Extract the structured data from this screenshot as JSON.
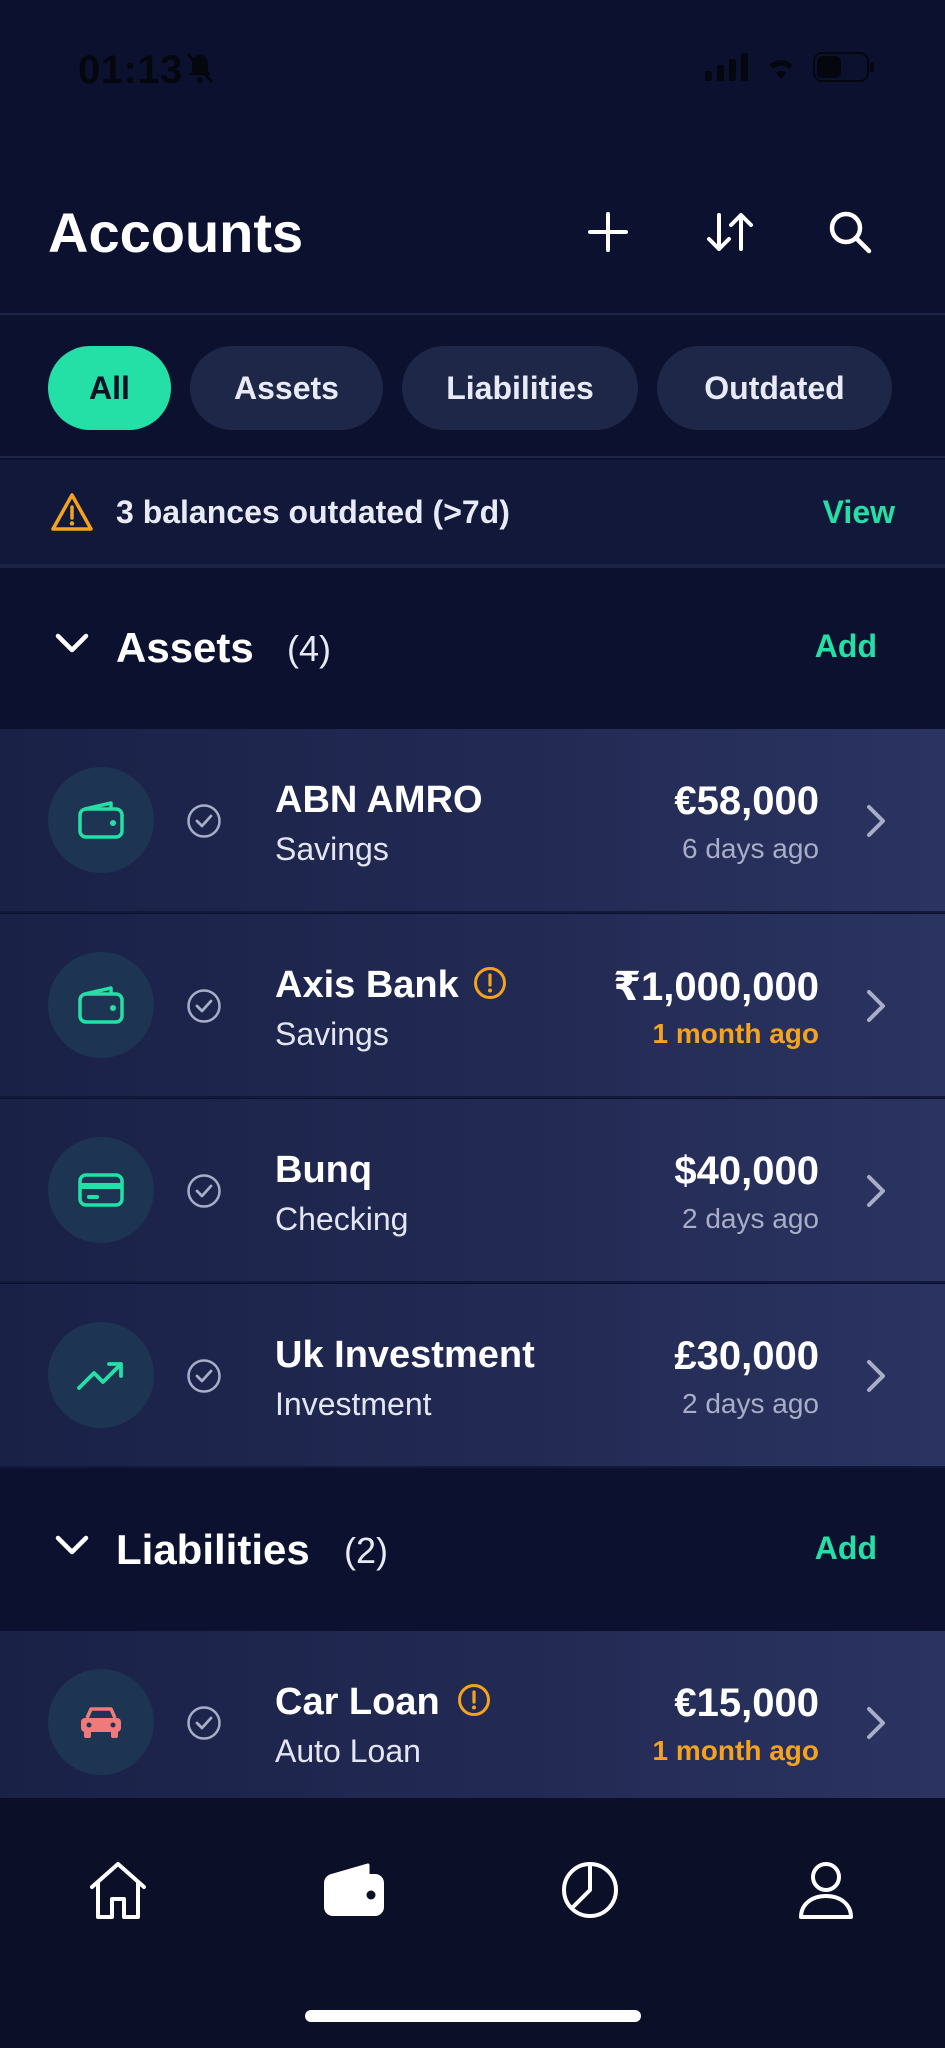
{
  "status_bar": {
    "time": "01:13"
  },
  "header": {
    "title": "Accounts"
  },
  "filters": [
    "All",
    "Assets",
    "Liabilities",
    "Outdated"
  ],
  "banner": {
    "text": "3 balances outdated (>7d)",
    "action": "View"
  },
  "sections": {
    "assets": {
      "title": "Assets",
      "count": "(4)",
      "add": "Add"
    },
    "liabilities": {
      "title": "Liabilities",
      "count": "(2)",
      "add": "Add"
    }
  },
  "accounts": [
    {
      "name": "ABN AMRO",
      "type": "Savings",
      "amount": "€58,000",
      "updated": "6 days ago",
      "icon": "wallet-icon"
    },
    {
      "name": "Axis Bank",
      "type": "Savings",
      "amount": "₹1,000,000",
      "updated": "1 month ago",
      "icon": "wallet-icon"
    },
    {
      "name": "Bunq",
      "type": "Checking",
      "amount": "$40,000",
      "updated": "2 days ago",
      "icon": "credit-card-icon"
    },
    {
      "name": "Uk Investment",
      "type": "Investment",
      "amount": "£30,000",
      "updated": "2 days ago",
      "icon": "trending-up-icon"
    }
  ],
  "liabilities": [
    {
      "name": "Car Loan",
      "type": "Auto Loan",
      "amount": "€15,000",
      "updated": "1 month ago",
      "icon": "car-icon"
    }
  ],
  "colors": {
    "accent": "#24e0a6",
    "warning": "#f5a21d",
    "background": "#0c1130",
    "liability_icon": "#f07a7a"
  },
  "tabbar": [
    "home-icon",
    "wallet-icon",
    "pie-chart-icon",
    "profile-icon"
  ]
}
